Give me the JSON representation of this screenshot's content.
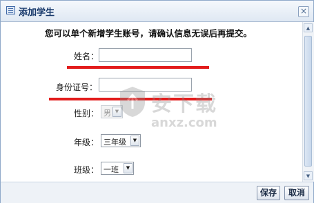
{
  "dialog": {
    "title": "添加学生",
    "close_symbol": "×",
    "icon": "form-list-icon"
  },
  "form": {
    "notice": "您可以单个新增学生账号，请确认信息无误后再提交。",
    "name_label": "姓名：",
    "name_value": "",
    "id_label": "身份证号：",
    "id_value": "",
    "gender_label": "性别：",
    "gender_value": "男",
    "grade_label": "年级：",
    "grade_value": "三年级",
    "class_label": "班级：",
    "class_value": "一班"
  },
  "buttons": {
    "save": "保存",
    "cancel": "取消"
  },
  "watermark": {
    "cn": "安下载",
    "en": "anxz.com"
  },
  "colors": {
    "title_text": "#18396b",
    "annotation_red": "#e21b1b",
    "border": "#8fa9c9"
  }
}
